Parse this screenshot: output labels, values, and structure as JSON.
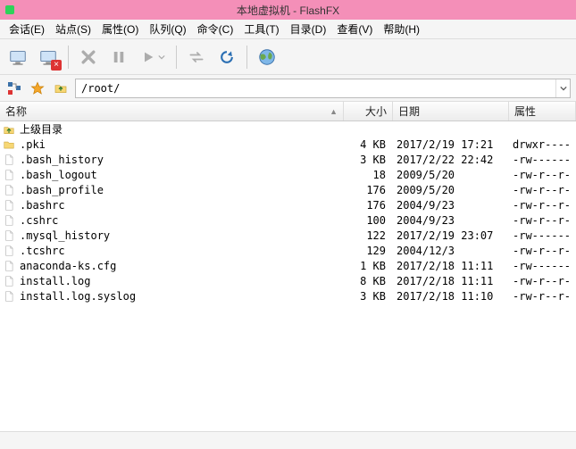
{
  "window": {
    "title": "本地虚拟机 - FlashFX"
  },
  "menu": {
    "items": [
      {
        "label": "会话(E)"
      },
      {
        "label": "站点(S)"
      },
      {
        "label": "属性(O)"
      },
      {
        "label": "队列(Q)"
      },
      {
        "label": "命令(C)"
      },
      {
        "label": "工具(T)"
      },
      {
        "label": "目录(D)"
      },
      {
        "label": "查看(V)"
      },
      {
        "label": "帮助(H)"
      }
    ]
  },
  "toolbar": {
    "path_value": "/root/"
  },
  "columns": {
    "name": "名称",
    "size": "大小",
    "date": "日期",
    "attr": "属性"
  },
  "files": [
    {
      "icon": "up",
      "name": "上级目录",
      "size": "",
      "date": "",
      "attr": ""
    },
    {
      "icon": "folder",
      "name": ".pki",
      "size": "4 KB",
      "date": "2017/2/19 17:21",
      "attr": "drwxr----"
    },
    {
      "icon": "file",
      "name": ".bash_history",
      "size": "3 KB",
      "date": "2017/2/22 22:42",
      "attr": "-rw------"
    },
    {
      "icon": "file",
      "name": ".bash_logout",
      "size": "18",
      "date": "2009/5/20",
      "attr": "-rw-r--r-"
    },
    {
      "icon": "file",
      "name": ".bash_profile",
      "size": "176",
      "date": "2009/5/20",
      "attr": "-rw-r--r-"
    },
    {
      "icon": "file",
      "name": ".bashrc",
      "size": "176",
      "date": "2004/9/23",
      "attr": "-rw-r--r-"
    },
    {
      "icon": "file",
      "name": ".cshrc",
      "size": "100",
      "date": "2004/9/23",
      "attr": "-rw-r--r-"
    },
    {
      "icon": "file",
      "name": ".mysql_history",
      "size": "122",
      "date": "2017/2/19 23:07",
      "attr": "-rw------"
    },
    {
      "icon": "file",
      "name": ".tcshrc",
      "size": "129",
      "date": "2004/12/3",
      "attr": "-rw-r--r-"
    },
    {
      "icon": "file",
      "name": "anaconda-ks.cfg",
      "size": "1 KB",
      "date": "2017/2/18 11:11",
      "attr": "-rw------"
    },
    {
      "icon": "file",
      "name": "install.log",
      "size": "8 KB",
      "date": "2017/2/18 11:11",
      "attr": "-rw-r--r-"
    },
    {
      "icon": "file",
      "name": "install.log.syslog",
      "size": "3 KB",
      "date": "2017/2/18 11:10",
      "attr": "-rw-r--r-"
    }
  ],
  "status": {
    "text": ""
  },
  "colors": {
    "accent": "#f48fb8"
  }
}
